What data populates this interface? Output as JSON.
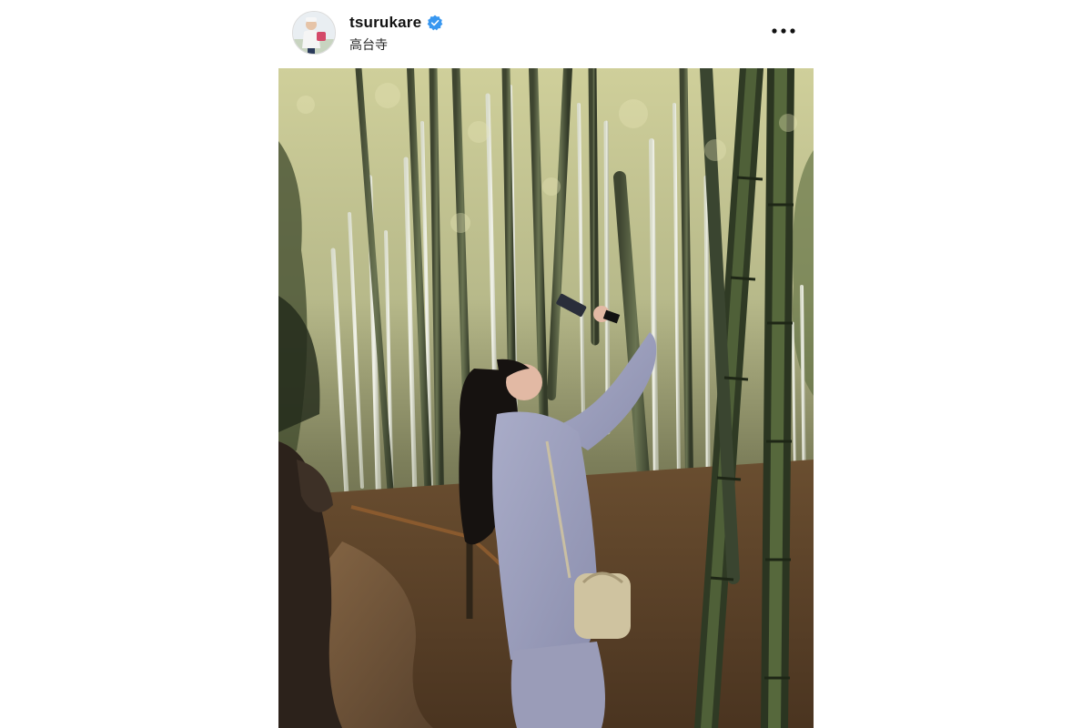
{
  "post": {
    "username": "tsurukare",
    "location": "高台寺",
    "verified": true,
    "icons": {
      "verified": "verified-badge-icon",
      "more": "more-options-icon"
    },
    "colors": {
      "verified_blue": "#3897f0",
      "text": "#111111"
    }
  }
}
